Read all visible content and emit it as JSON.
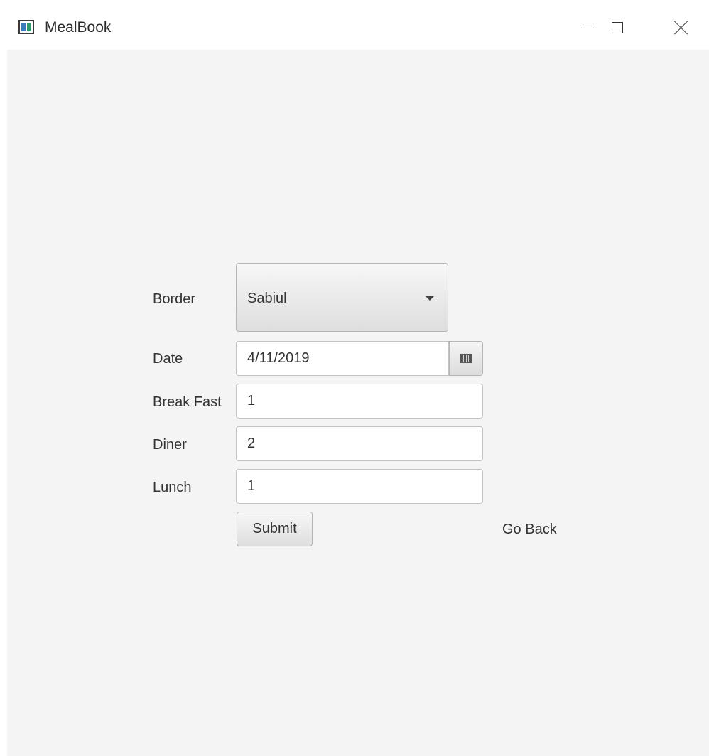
{
  "window": {
    "title": "MealBook",
    "icon": "app-window-icon",
    "controls": {
      "minimize": "minimize-icon",
      "maximize": "maximize-icon",
      "close": "close-icon"
    }
  },
  "form": {
    "border": {
      "label": "Border",
      "selected": "Sabiul"
    },
    "date": {
      "label": "Date",
      "value": "4/11/2019",
      "picker_icon": "calendar-icon"
    },
    "breakfast": {
      "label": "Break Fast",
      "value": "1"
    },
    "diner": {
      "label": "Diner",
      "value": "2"
    },
    "lunch": {
      "label": "Lunch",
      "value": "1"
    },
    "submit_label": "Submit",
    "go_back_label": "Go Back"
  },
  "colors": {
    "content_background": "#f4f4f4",
    "text": "#333333",
    "control_border": "#b5b5b5"
  }
}
